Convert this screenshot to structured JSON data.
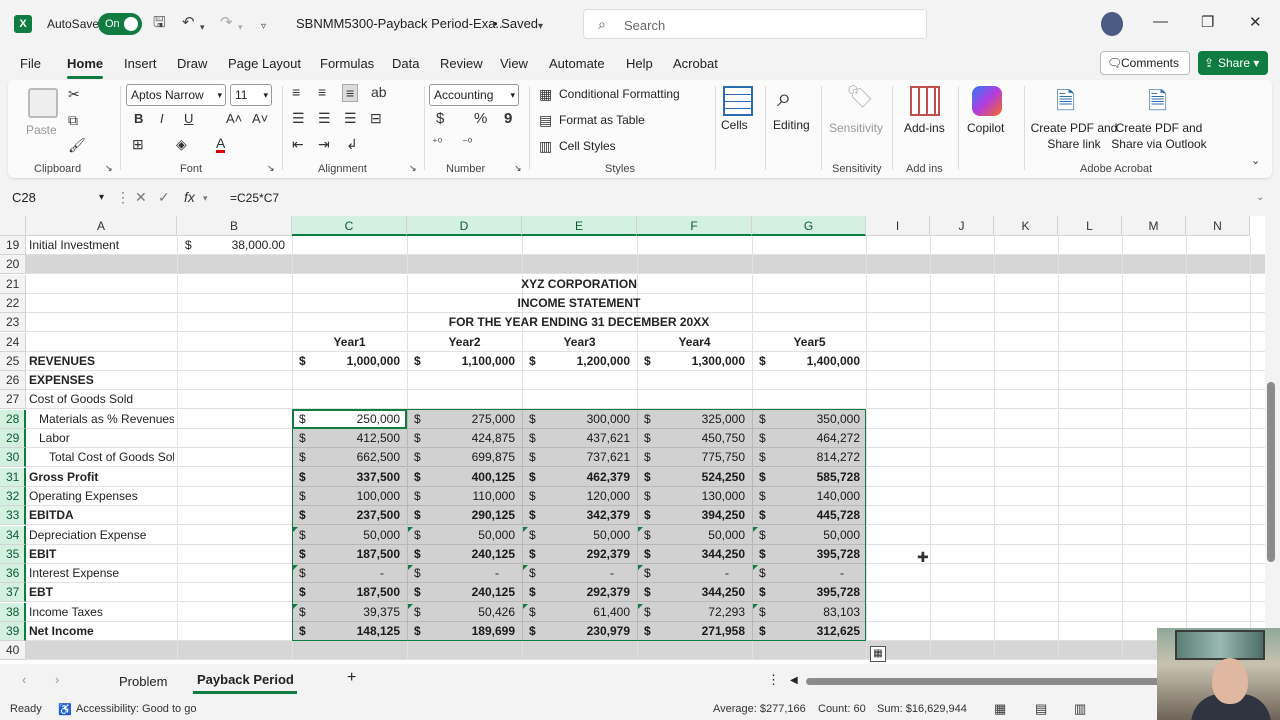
{
  "titlebar": {
    "autosave_label": "AutoSave",
    "toggle_label": "On",
    "doc_title": "SBNMM5300-Payback Period-Exa...",
    "saved_status": "• Saved",
    "search_placeholder": "Search"
  },
  "menu": {
    "items": [
      "File",
      "Home",
      "Insert",
      "Draw",
      "Page Layout",
      "Formulas",
      "Data",
      "Review",
      "View",
      "Automate",
      "Help",
      "Acrobat"
    ],
    "active": "Home",
    "comments_label": "Comments",
    "share_label": "Share"
  },
  "ribbon": {
    "clipboard": {
      "paste_label": "Paste",
      "group_label": "Clipboard"
    },
    "font": {
      "font_name": "Aptos Narrow",
      "font_size": "11",
      "group_label": "Font"
    },
    "alignment": {
      "group_label": "Alignment"
    },
    "number": {
      "format": "Accounting",
      "currency": "$",
      "percent": "%",
      "comma": "9",
      "group_label": "Number"
    },
    "styles": {
      "conditional_formatting": "Conditional Formatting",
      "format_as_table": "Format as Table",
      "cell_styles": "Cell Styles",
      "group_label": "Styles"
    },
    "cells_label": "Cells",
    "editing_label": "Editing",
    "sensitivity_label": "Sensitivity",
    "sensitivity_group": "Sensitivity",
    "addins_label": "Add-ins",
    "addins_group": "Add ins",
    "copilot_label": "Copilot",
    "acrobat": {
      "create_pdf_share": "Create PDF and Share link",
      "create_pdf_outlook": "Create PDF and Share via Outlook",
      "group_label": "Adobe Acrobat"
    }
  },
  "formula_bar": {
    "name_box": "C28",
    "fx": "fx",
    "formula": "=C25*C7"
  },
  "columns": [
    "A",
    "B",
    "C",
    "D",
    "E",
    "F",
    "G",
    "I",
    "J",
    "K",
    "L",
    "M",
    "N"
  ],
  "rows": {
    "r19": {
      "num": "19",
      "label": "Initial Investment",
      "b_dollar": "$",
      "b_value": "38,000.00"
    },
    "r20": {
      "num": "20"
    },
    "r21": {
      "num": "21",
      "text": "XYZ CORPORATION"
    },
    "r22": {
      "num": "22",
      "text": "INCOME STATEMENT"
    },
    "r23": {
      "num": "23",
      "text": "FOR THE YEAR ENDING 31 DECEMBER 20XX"
    },
    "r24": {
      "num": "24",
      "years": [
        "Year1",
        "Year2",
        "Year3",
        "Year4",
        "Year5"
      ]
    },
    "r25": {
      "num": "25",
      "label": "REVENUES",
      "values": [
        "1,000,000",
        "1,100,000",
        "1,200,000",
        "1,300,000",
        "1,400,000"
      ]
    },
    "r26": {
      "num": "26",
      "label": "EXPENSES"
    },
    "r27": {
      "num": "27",
      "label": "Cost of Goods Sold"
    },
    "r28": {
      "num": "28",
      "label": "Materials as % Revenues",
      "values": [
        "250,000",
        "275,000",
        "300,000",
        "325,000",
        "350,000"
      ]
    },
    "r29": {
      "num": "29",
      "label": "Labor",
      "values": [
        "412,500",
        "424,875",
        "437,621",
        "450,750",
        "464,272"
      ]
    },
    "r30": {
      "num": "30",
      "label": "Total Cost of Goods Sold",
      "values": [
        "662,500",
        "699,875",
        "737,621",
        "775,750",
        "814,272"
      ]
    },
    "r31": {
      "num": "31",
      "label": "Gross Profit",
      "values": [
        "337,500",
        "400,125",
        "462,379",
        "524,250",
        "585,728"
      ]
    },
    "r32": {
      "num": "32",
      "label": "Operating Expenses",
      "values": [
        "100,000",
        "110,000",
        "120,000",
        "130,000",
        "140,000"
      ]
    },
    "r33": {
      "num": "33",
      "label": "EBITDA",
      "values": [
        "237,500",
        "290,125",
        "342,379",
        "394,250",
        "445,728"
      ]
    },
    "r34": {
      "num": "34",
      "label": "Depreciation Expense",
      "values": [
        "50,000",
        "50,000",
        "50,000",
        "50,000",
        "50,000"
      ]
    },
    "r35": {
      "num": "35",
      "label": "EBIT",
      "values": [
        "187,500",
        "240,125",
        "292,379",
        "344,250",
        "395,728"
      ]
    },
    "r36": {
      "num": "36",
      "label": "Interest Expense",
      "values": [
        "-",
        "-",
        "-",
        "-",
        "-"
      ]
    },
    "r37": {
      "num": "37",
      "label": "EBT",
      "values": [
        "187,500",
        "240,125",
        "292,379",
        "344,250",
        "395,728"
      ]
    },
    "r38": {
      "num": "38",
      "label": "Income Taxes",
      "values": [
        "39,375",
        "50,426",
        "61,400",
        "72,293",
        "83,103"
      ]
    },
    "r39": {
      "num": "39",
      "label": "Net Income",
      "values": [
        "148,125",
        "189,699",
        "230,979",
        "271,958",
        "312,625"
      ]
    },
    "r40": {
      "num": "40"
    }
  },
  "currency_symbol": "$",
  "sheets": {
    "tabs": [
      "Problem",
      "Payback Period"
    ],
    "active": "Payback Period",
    "add": "+"
  },
  "status": {
    "ready": "Ready",
    "accessibility": "Accessibility: Good to go",
    "average": "Average: $277,166",
    "count": "Count: 60",
    "sum": "Sum: $16,629,944"
  }
}
